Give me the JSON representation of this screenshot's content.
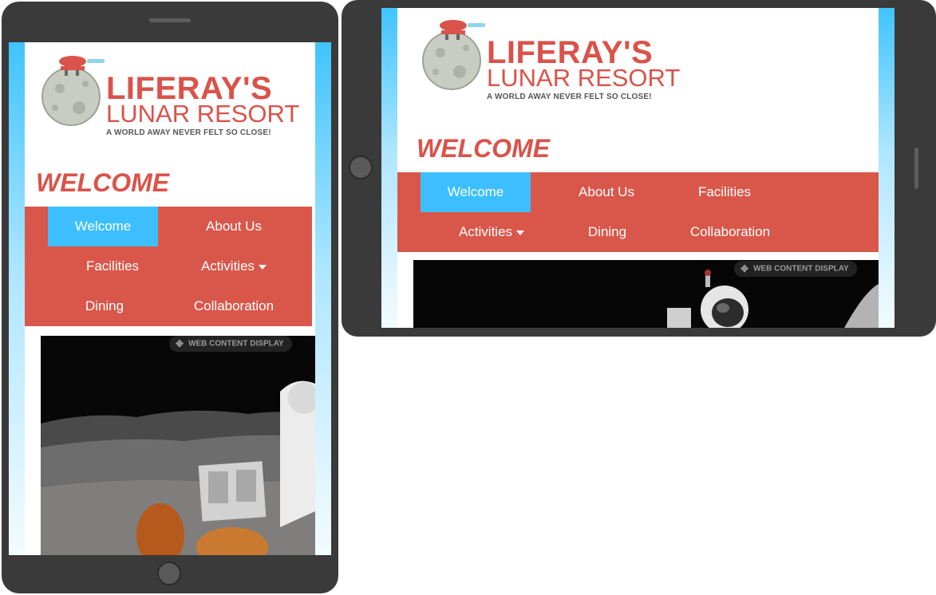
{
  "brand": {
    "line1": "LIFERAY'S",
    "line2": "LUNAR RESORT",
    "tagline": "A WORLD AWAY NEVER FELT SO CLOSE!",
    "logo_icon": "moon-logo-icon"
  },
  "heading": "WELCOME",
  "nav": {
    "welcome": "Welcome",
    "about": "About Us",
    "facilities": "Facilities",
    "activities": "Activities",
    "dining": "Dining",
    "collaboration": "Collaboration"
  },
  "portlet": {
    "label": "WEB CONTENT DISPLAY",
    "move_icon": "move-icon"
  },
  "colors": {
    "brand_red": "#d9534a",
    "nav_background": "#d9574a",
    "nav_active": "#3dbfff",
    "device_frame": "#3a3a3a"
  }
}
